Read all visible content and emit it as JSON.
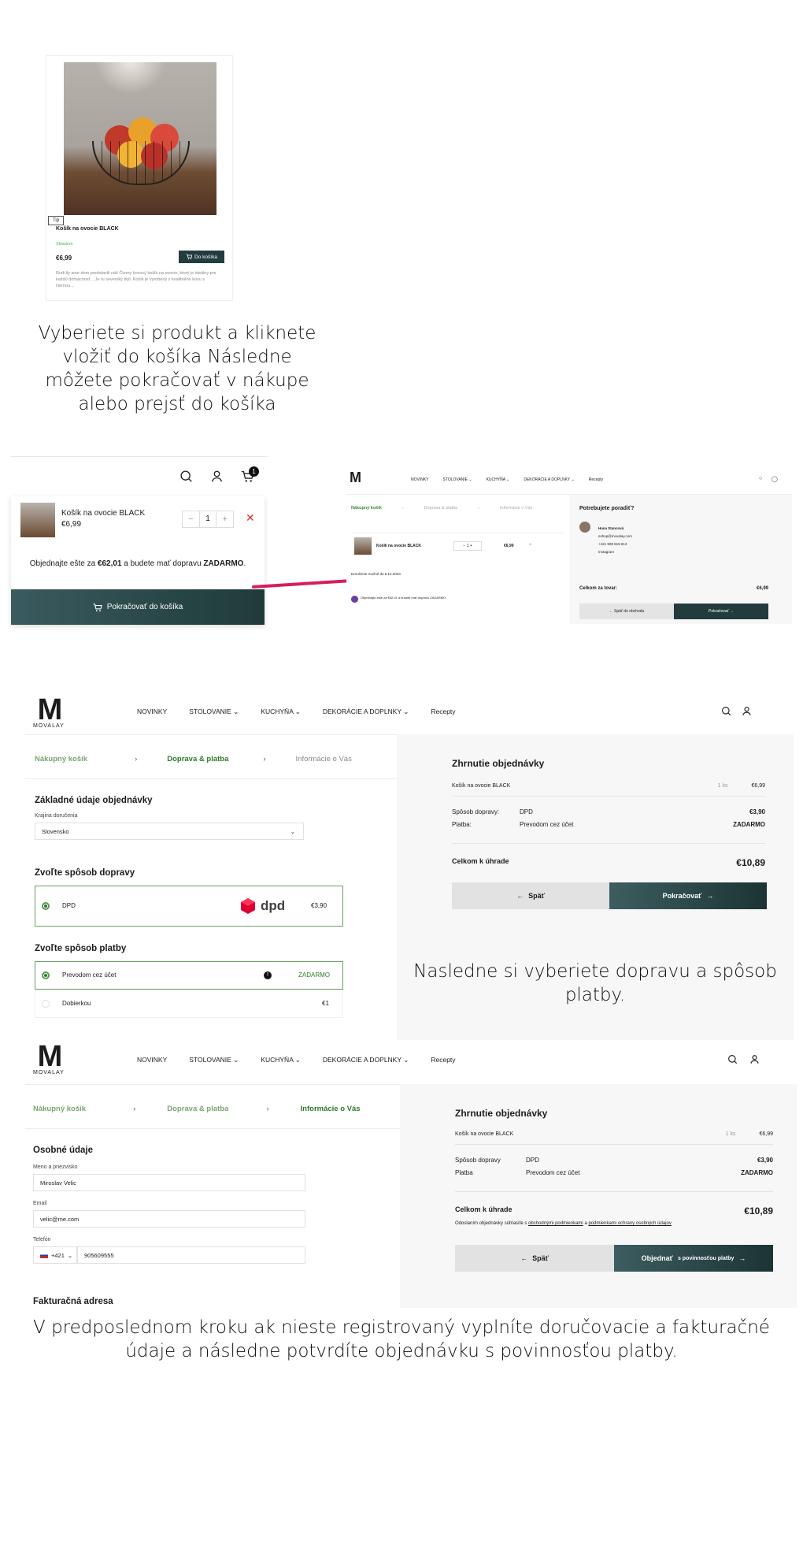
{
  "product_card": {
    "name": "Košík na ovocie BLACK",
    "stock": "Skladom",
    "price": "€6,99",
    "button": "Do košíka",
    "description": "Rudi ily sme dom predstavili náš Čierny kovový košík na ovocie, ktorý je ideálny pre každú domácnosť... Je tu severský štýl. Košík je vyrobený z kvalitného kovu s čiernou..."
  },
  "caption1": "Vyberiete si produkt a kliknete vložiť do košíka Následne môžete pokračovať v nákupe alebo prejsť do košíka",
  "mini_cart": {
    "cart_count": "1",
    "item_name": "Košík na ovocie BLACK",
    "item_price": "€6,99",
    "qty": "1",
    "free_shipping_prefix": "Objednajte ešte za",
    "free_shipping_amount": "€62,01",
    "free_shipping_middle": "a budete mať dopravu",
    "free_shipping_word": "ZADARMO",
    "free_shipping_end": ".",
    "continue_button": "Pokračovať do košíka"
  },
  "small_page": {
    "nav": [
      "NOVINKY",
      "STOLOVANIE ⌄",
      "KUCHYŇA ⌄",
      "DEKORÁCIE A DOPLNKY ⌄",
      "Recepty"
    ],
    "steps": [
      "Nákupný košík",
      "Doprava & platba",
      "Informácie o Vás"
    ],
    "item_name": "Košík na ovocie BLACK",
    "item_qty": "1",
    "item_price": "€6,99",
    "delivery_note": "Doručenie možné do 6.12.2023",
    "free_note": "Objednajte ešte za €62,01 a budete mať dopravu ZADARMO",
    "help_title": "Potrebujete poradiť?",
    "help_name": "Hana Stancová",
    "help_email": "eshop@movalay.com",
    "help_phone": "+421 908 815 813",
    "help_instagram": "Instagram",
    "total_label": "Celkom za tovar:",
    "total_value": "€6,99",
    "back": "← Späť do obchodu",
    "next": "Pokračovať →"
  },
  "header": {
    "logo": "M",
    "logo_sub": "MOVALAY",
    "nav": [
      "NOVINKY",
      "STOLOVANIE ⌄",
      "KUCHYŇA ⌄",
      "DEKORÁCIE A DOPLNKY ⌄",
      "Recepty"
    ]
  },
  "step2": {
    "steps": [
      "Nákupný košík",
      "Doprava & platba",
      "Informácie o Vás"
    ],
    "basic_title": "Základné údaje objednávky",
    "country_label": "Krajina doručenia",
    "country_value": "Slovensko",
    "shipping_title": "Zvoľte spôsob dopravy",
    "shipping": {
      "name": "DPD",
      "logo": "dpd",
      "price": "€3,90"
    },
    "payment_title": "Zvoľte spôsob platby",
    "payments": [
      {
        "name": "Prevodom cez účet",
        "price": "ZADARMO",
        "selected": true
      },
      {
        "name": "Dobierkou",
        "price": "€1",
        "selected": false
      }
    ],
    "summary": {
      "title": "Zhrnutie objednávky",
      "item": "Košík na ovocie BLACK",
      "qty": "1 ks",
      "item_price": "€6,99",
      "ship_label": "Spôsob dopravy:",
      "ship_value": "DPD",
      "ship_price": "€3,90",
      "pay_label": "Platba:",
      "pay_value": "Prevodom cez účet",
      "pay_price": "ZADARMO",
      "total_label": "Celkom k úhrade",
      "total_value": "€10,89",
      "back": "Späť",
      "next": "Pokračovať"
    }
  },
  "caption2": "Nasledne si vyberiete dopravu a spôsob platby.",
  "step3": {
    "steps": [
      "Nákupný košík",
      "Doprava & platba",
      "Informácie o Vás"
    ],
    "personal_title": "Osobné údaje",
    "name_label": "Meno a priezvisko",
    "name_value": "Miroslav Velic",
    "email_label": "Email",
    "email_value": "velic@me.com",
    "phone_label": "Telefón",
    "phone_prefix": "+421",
    "phone_value": "905609555",
    "billing_title": "Fakturačná adresa",
    "summary": {
      "title": "Zhrnutie objednávky",
      "item": "Košík na ovocie BLACK",
      "qty": "1 ks",
      "item_price": "€6,99",
      "ship_label": "Spôsob dopravy",
      "ship_value": "DPD",
      "ship_price": "€3,90",
      "pay_label": "Platba",
      "pay_value": "Prevodom cez účet",
      "pay_price": "ZADARMO",
      "total_label": "Celkom k úhrade",
      "total_value": "€10,89",
      "terms_prefix": "Odoslaním objednávky súhlasíte s",
      "terms_link1": "obchodnými podmienkami",
      "terms_middle": "a",
      "terms_link2": "podmienkami ochrany osobných údajov",
      "back": "Späť",
      "next": "Objednať",
      "next_suffix": "s povinnosťou platby"
    }
  },
  "caption3": "V predposlednom kroku ak nieste registrovaný vyplníte doručovacie a fakturačné údaje a následne potvrdíte objednávku s povinnosťou platby.",
  "colors": {
    "accent": "#223b3d",
    "green": "#2d7a2a",
    "pink": "#d61e5e",
    "summary_bg": "#f7f7f7"
  }
}
